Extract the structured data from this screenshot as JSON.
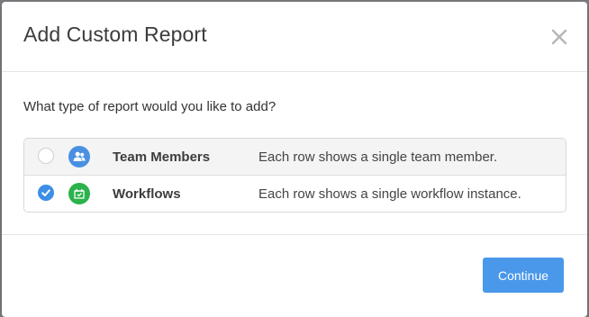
{
  "dialog": {
    "title": "Add Custom Report",
    "close_icon": "close-icon",
    "question": "What type of report would you like to add?",
    "options": [
      {
        "name": "Team Members",
        "description": "Each row shows a single team member.",
        "icon": "team-members-icon",
        "icon_color": "#4a90e2",
        "selected": false
      },
      {
        "name": "Workflows",
        "description": "Each row shows a single workflow instance.",
        "icon": "workflow-icon",
        "icon_color": "#2bb24c",
        "selected": true
      }
    ],
    "continue_label": "Continue"
  },
  "colors": {
    "accent": "#4a98ea",
    "backdrop": "#7d7f83"
  }
}
